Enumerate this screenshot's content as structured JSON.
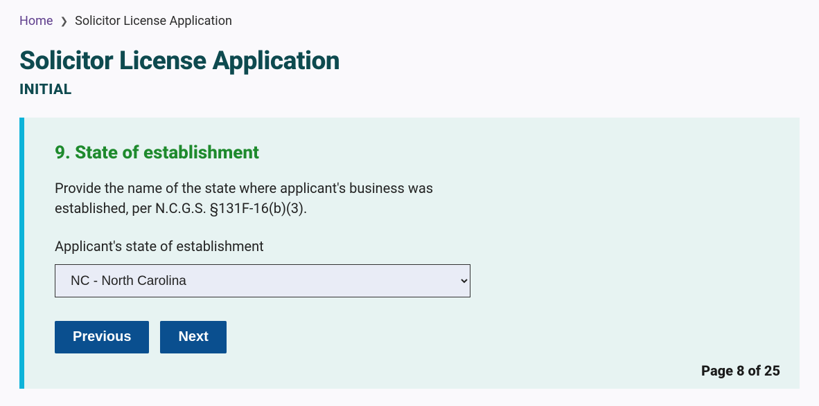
{
  "breadcrumb": {
    "home_label": "Home",
    "current_label": "Solicitor License Application"
  },
  "header": {
    "title": "Solicitor License Application",
    "subtitle": "INITIAL"
  },
  "section": {
    "title": "9. State of establishment",
    "instruction": "Provide the name of the state where applicant's business was established, per N.C.G.S. §131F-16(b)(3).",
    "field_label": "Applicant's state of establishment",
    "selected_value": "NC - North Carolina"
  },
  "buttons": {
    "previous": "Previous",
    "next": "Next"
  },
  "pagination": {
    "text": "Page 8 of 25"
  }
}
